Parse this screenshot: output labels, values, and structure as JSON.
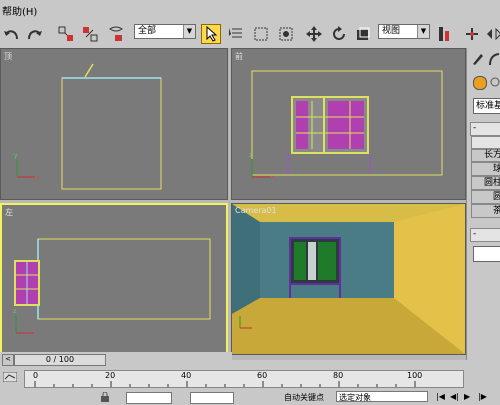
{
  "menu": {
    "help_label": "帮助(H)"
  },
  "toolbar": {
    "selection_filter": "全部",
    "ref_coord": "视图"
  },
  "viewports": {
    "top_label": "顶",
    "front_label": "前",
    "left_label": "左",
    "camera_label": "Camera01"
  },
  "command_panel": {
    "dropdown": "标准基",
    "buttons": [
      "长方",
      "球",
      "圆柱",
      "圆",
      "茶"
    ],
    "section_minus": "-"
  },
  "timeslider": {
    "value": "0 / 100"
  },
  "trackbar": {
    "ticks": [
      "0",
      "20",
      "40",
      "60",
      "80",
      "100"
    ]
  },
  "status": {
    "autokey_label": "自动关键点",
    "selected_label": "选定对象"
  },
  "colors": {
    "viewport_bg": "#7a7a7a",
    "active_border": "#f2f25a",
    "wall": "#4a7c86",
    "floor_ceiling": "#c9b040"
  }
}
